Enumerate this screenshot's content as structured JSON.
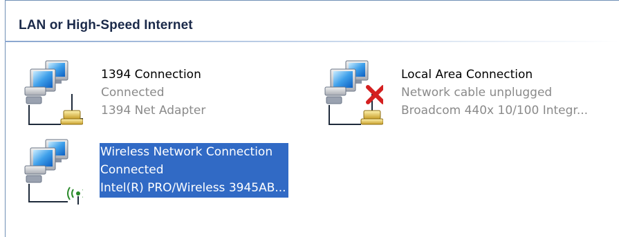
{
  "group": {
    "title": "LAN or High-Speed Internet"
  },
  "connections": [
    {
      "name": "1394 Connection",
      "status": "Connected",
      "device": "1394 Net Adapter",
      "icon": "lan-adapter-icon"
    },
    {
      "name": "Local Area Connection",
      "status": "Network cable unplugged",
      "device": "Broadcom 440x 10/100 Integr...",
      "icon": "lan-disconnected-icon"
    },
    {
      "name": "Wireless Network Connection",
      "status": "Connected",
      "device": "Intel(R) PRO/Wireless 3945AB...",
      "icon": "wireless-adapter-icon",
      "selected": true
    }
  ],
  "colors": {
    "selection": "#316ac5",
    "disconnected_x": "#d42020",
    "secondary_text": "#8a8a8a"
  }
}
